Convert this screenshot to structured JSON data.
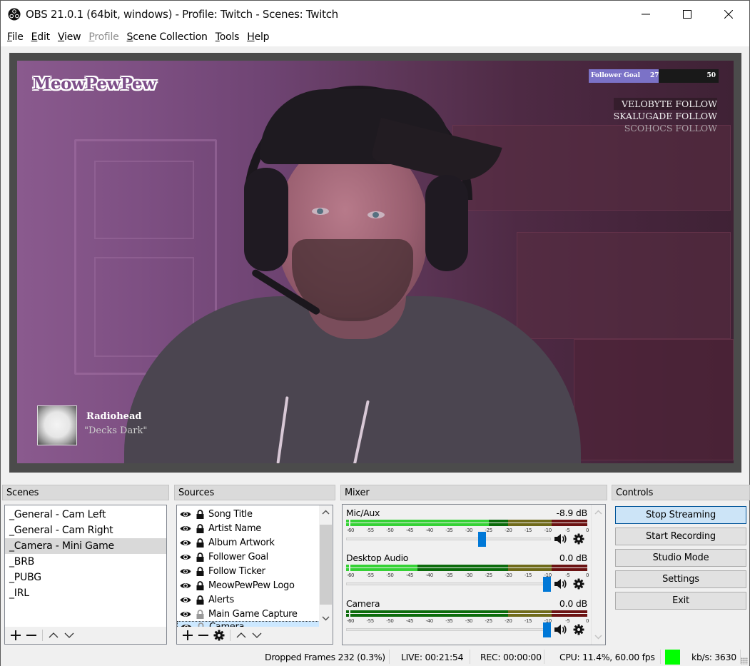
{
  "window": {
    "title": "OBS 21.0.1 (64bit, windows) - Profile: Twitch - Scenes: Twitch",
    "controls": [
      "minimize",
      "maximize",
      "close"
    ]
  },
  "menu": [
    {
      "label": "File",
      "accel": "F",
      "rest": "ile",
      "disabled": false
    },
    {
      "label": "Edit",
      "accel": "E",
      "rest": "dit",
      "disabled": false
    },
    {
      "label": "View",
      "accel": "V",
      "rest": "iew",
      "disabled": false
    },
    {
      "label": "Profile",
      "accel": "P",
      "rest": "rofile",
      "disabled": true
    },
    {
      "label": "Scene Collection",
      "accel": "S",
      "rest": "cene Collection",
      "disabled": false
    },
    {
      "label": "Tools",
      "accel": "T",
      "rest": "ools",
      "disabled": false
    },
    {
      "label": "Help",
      "accel": "H",
      "rest": "elp",
      "disabled": false
    }
  ],
  "preview": {
    "logo_text": "MeowPewPew",
    "follower_goal": {
      "label": "Follower Goal",
      "current": "27",
      "target": "50",
      "progress": 0.54
    },
    "follow_ticker": [
      {
        "name": "VELOBYTE",
        "action": "FOLLOW"
      },
      {
        "name": "SKALUGADE",
        "action": "FOLLOW"
      },
      {
        "name": "SCOHOCS",
        "action": "FOLLOW"
      }
    ],
    "now_playing": {
      "artist": "Radiohead",
      "song": "\"Decks Dark\""
    }
  },
  "scenes": {
    "title": "Scenes",
    "items": [
      "_General - Cam Left",
      "_General - Cam Right",
      "_Camera - Mini Game",
      "_BRB",
      "_PUBG",
      "_IRL"
    ],
    "selected_index": 2
  },
  "sources": {
    "title": "Sources",
    "items": [
      {
        "name": "Song Title",
        "visible": true,
        "locked": true
      },
      {
        "name": "Artist Name",
        "visible": true,
        "locked": true
      },
      {
        "name": "Album Artwork",
        "visible": true,
        "locked": true
      },
      {
        "name": "Follower Goal",
        "visible": true,
        "locked": true
      },
      {
        "name": "Follow Ticker",
        "visible": true,
        "locked": true
      },
      {
        "name": "MeowPewPew Logo",
        "visible": true,
        "locked": true
      },
      {
        "name": "Alerts",
        "visible": true,
        "locked": true
      },
      {
        "name": "Main Game Capture",
        "visible": true,
        "locked": false
      },
      {
        "name": "Camera",
        "visible": true,
        "locked": false,
        "selected": true
      }
    ]
  },
  "mixer": {
    "title": "Mixer",
    "scale_ticks": [
      "-60",
      "-55",
      "-50",
      "-45",
      "-40",
      "-35",
      "-30",
      "-25",
      "-20",
      "-15",
      "-10",
      "-5",
      "0"
    ],
    "channels": [
      {
        "name": "Mic/Aux",
        "db": "-8.9 dB",
        "volume_db": -8.9,
        "fader_fraction": 0.67,
        "level_db": -25
      },
      {
        "name": "Desktop Audio",
        "db": "0.0 dB",
        "volume_db": 0.0,
        "fader_fraction": 1.0,
        "level_db": -43
      },
      {
        "name": "Camera",
        "db": "0.0 dB",
        "volume_db": 0.0,
        "fader_fraction": 1.0,
        "level_db": -60
      }
    ],
    "colors": {
      "green": "#0b6b0b",
      "green_active": "#35d235",
      "yellow": "#6f6a1a",
      "red": "#6b1212",
      "fader": "#0078d7"
    }
  },
  "controls": {
    "title": "Controls",
    "buttons": [
      "Stop Streaming",
      "Start Recording",
      "Studio Mode",
      "Settings",
      "Exit"
    ],
    "active_index": 0
  },
  "status": {
    "dropped": "Dropped Frames 232 (0.3%)",
    "live": "LIVE: 00:21:54",
    "rec": "REC: 00:00:00",
    "cpu": "CPU: 11.4%, 60.00 fps",
    "indicator_color": "#00ff00",
    "kbps": "kb/s: 3630"
  }
}
